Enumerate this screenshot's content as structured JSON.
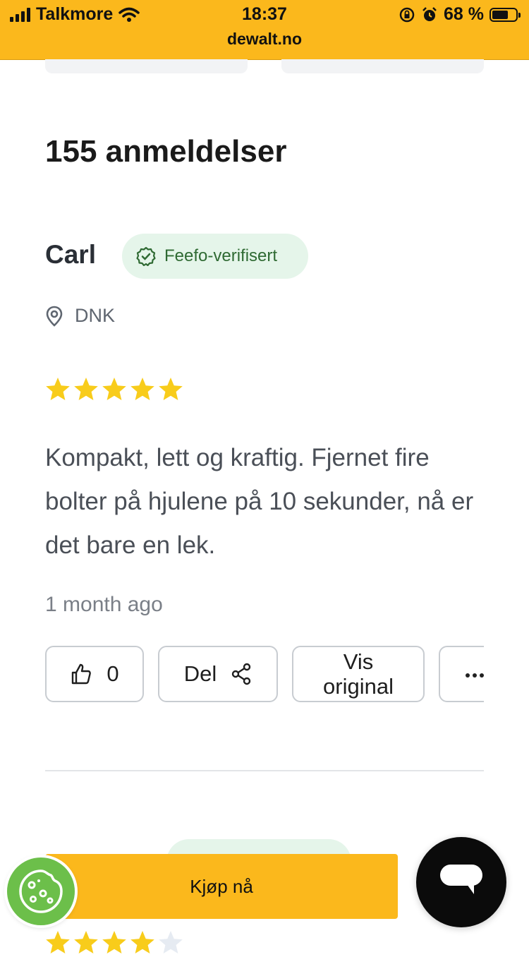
{
  "status_bar": {
    "carrier": "Talkmore",
    "time": "18:37",
    "url": "dewalt.no",
    "battery": "68 %",
    "battery_level": 0.68
  },
  "reviews_heading": "155 anmeldelser",
  "review": {
    "author": "Carl",
    "badge": "Feefo-verifisert",
    "location": "DNK",
    "rating": 5,
    "rating_max": 5,
    "text": "Kompakt, lett og kraftig. Fjernet fire bolter på hjulene på 10 sekunder, nå er det bare en lek.",
    "time": "1 month ago",
    "actions": {
      "like_count": "0",
      "share_label": "Del",
      "original_label_line1": "Vis",
      "original_label_line2": "original"
    }
  },
  "next_review": {
    "rating": 4,
    "rating_max": 5
  },
  "buy_button": "Kjøp nå",
  "colors": {
    "accent": "#fbb81c",
    "verified_bg": "#e5f5ea",
    "verified_text": "#2f6a33",
    "star": "#f8cc1b",
    "cookie": "#6cbf4a"
  },
  "icons": {
    "status": [
      "signal-icon",
      "wifi-icon",
      "orientation-lock-icon",
      "alarm-icon",
      "battery-icon"
    ],
    "review": [
      "verified-check-icon",
      "location-pin-icon",
      "star-icon",
      "thumbs-up-icon",
      "share-icon",
      "more-icon"
    ],
    "floating": [
      "cookie-icon",
      "chat-icon"
    ]
  }
}
